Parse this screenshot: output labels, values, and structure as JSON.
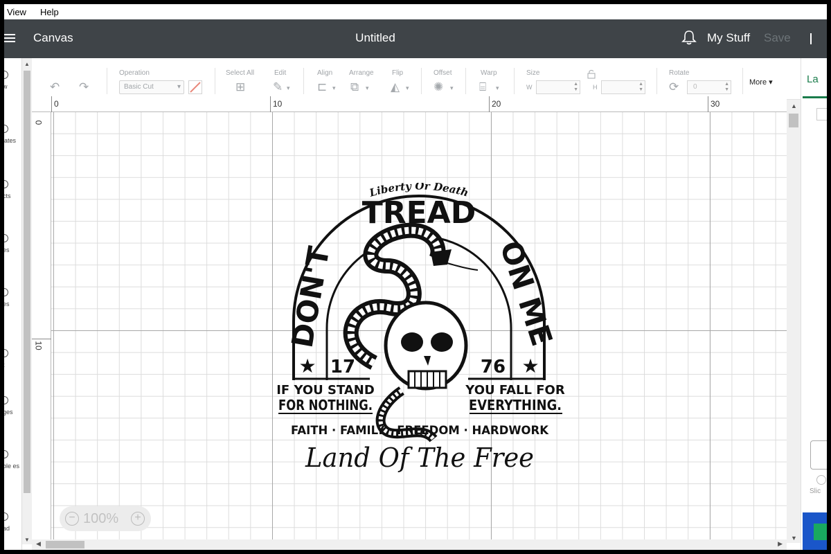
{
  "menu": {
    "items": [
      "View",
      "Help"
    ]
  },
  "header": {
    "app_name": "Canvas",
    "document_title": "Untitled",
    "my_stuff": "My Stuff",
    "save": "Save"
  },
  "toolbar": {
    "operation_label": "Operation",
    "operation_value": "Basic Cut",
    "select_all_label": "Select All",
    "edit_label": "Edit",
    "align_label": "Align",
    "arrange_label": "Arrange",
    "flip_label": "Flip",
    "offset_label": "Offset",
    "warp_label": "Warp",
    "size_label": "Size",
    "size_w": "W",
    "size_h": "H",
    "rotate_label": "Rotate",
    "rotate_value": "0",
    "more_label": "More"
  },
  "left_sidebar": {
    "items": [
      "w",
      "lates",
      "cts",
      "es",
      "es",
      "t",
      "ges",
      "ble es",
      "ad"
    ]
  },
  "right_panel": {
    "tab_label": "La",
    "slice_label": "Slic"
  },
  "ruler": {
    "top": [
      "0",
      "10",
      "20",
      "30"
    ],
    "left": [
      "0",
      "10"
    ]
  },
  "zoom": {
    "value": "100%"
  },
  "design": {
    "top_text": "Liberty Or Death",
    "arc_left": "DON'T",
    "arc_top": "TREAD",
    "arc_right": "ON ME",
    "year_left": "17",
    "year_right": "76",
    "left_line1": "IF YOU STAND",
    "left_line2": "FOR NOTHING.",
    "right_line1": "YOU FALL FOR",
    "right_line2": "EVERYTHING.",
    "values_line": "FAITH · FAMILY · FREEDOM · HARDWORK",
    "script_line": "Land Of The Free"
  },
  "colors": {
    "header_bg": "#3f4448",
    "accent_green": "#1a7c4b",
    "save_disabled": "#6d7478"
  }
}
